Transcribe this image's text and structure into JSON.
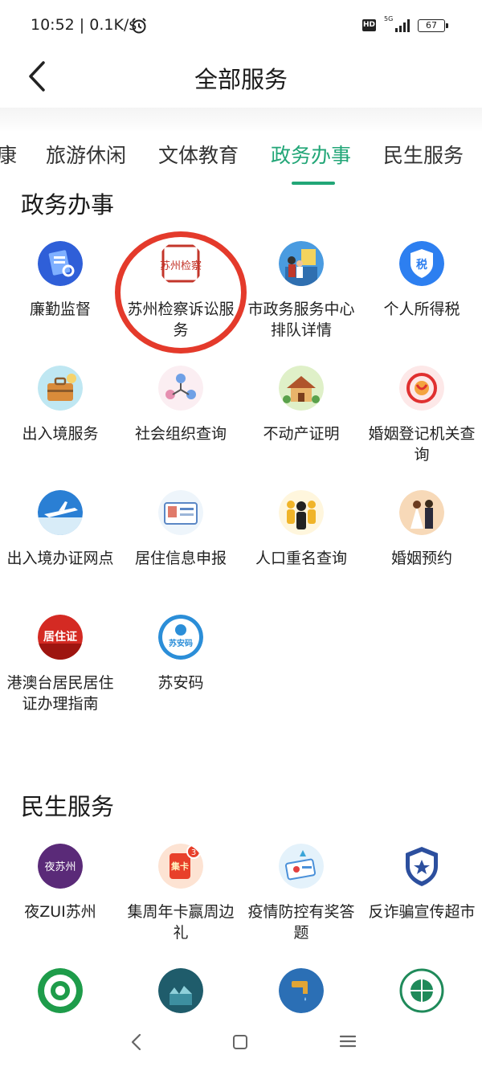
{
  "status_bar": {
    "time_speed": "10:52 | 0.1K/s",
    "hd": "HD",
    "network": "5G",
    "battery": "67"
  },
  "header": {
    "title": "全部服务"
  },
  "tabs": [
    {
      "label": "康"
    },
    {
      "label": "旅游休闲"
    },
    {
      "label": "文体教育"
    },
    {
      "label": "政务办事"
    },
    {
      "label": "民生服务"
    }
  ],
  "active_tab": "政务办事",
  "sections": [
    {
      "title": "政务办事",
      "items": [
        {
          "label": "廉勤监督",
          "icon": "integrity-supervision-icon"
        },
        {
          "label": "苏州检察诉讼服务",
          "icon": "procuratorate-seal-icon"
        },
        {
          "label": "市政务服务中心排队详情",
          "icon": "queue-details-icon"
        },
        {
          "label": "个人所得税",
          "icon": "tax-shield-icon"
        },
        {
          "label": "出入境服务",
          "icon": "suitcase-icon"
        },
        {
          "label": "社会组织查询",
          "icon": "organization-icon"
        },
        {
          "label": "不动产证明",
          "icon": "house-icon"
        },
        {
          "label": "婚姻登记机关查询",
          "icon": "marriage-registry-icon"
        },
        {
          "label": "出入境办证网点",
          "icon": "airplane-icon"
        },
        {
          "label": "居住信息申报",
          "icon": "residence-card-icon"
        },
        {
          "label": "人口重名查询",
          "icon": "people-icon"
        },
        {
          "label": "婚姻预约",
          "icon": "wedding-couple-icon"
        },
        {
          "label": "港澳台居民居住证办理指南",
          "icon": "residence-permit-icon"
        },
        {
          "label": "苏安码",
          "icon": "su-an-code-icon"
        }
      ]
    },
    {
      "title": "民生服务",
      "items": [
        {
          "label": "夜ZUI苏州",
          "icon": "night-suzhou-icon"
        },
        {
          "label": "集周年卡赢周边礼",
          "icon": "collect-card-icon"
        },
        {
          "label": "疫情防控有奖答题",
          "icon": "epidemic-quiz-icon"
        },
        {
          "label": "反诈骗宣传超市",
          "icon": "anti-fraud-badge-icon"
        },
        {
          "label": "",
          "icon": "green-emblem-icon"
        },
        {
          "label": "",
          "icon": "city-scan-icon"
        },
        {
          "label": "",
          "icon": "water-tap-icon"
        },
        {
          "label": "",
          "icon": "globe-emblem-icon"
        }
      ]
    }
  ],
  "badges": {
    "collect_card_count": "3",
    "collect_card_text": "集卡",
    "residence_permit_text": "居住证",
    "su_an_code_text": "苏安码",
    "night_suzhou_text": "夜苏州",
    "tax_text": "税",
    "seal_text": "苏州检察"
  },
  "colors": {
    "accent": "#22a677",
    "highlight_ring": "#e43a2b"
  }
}
